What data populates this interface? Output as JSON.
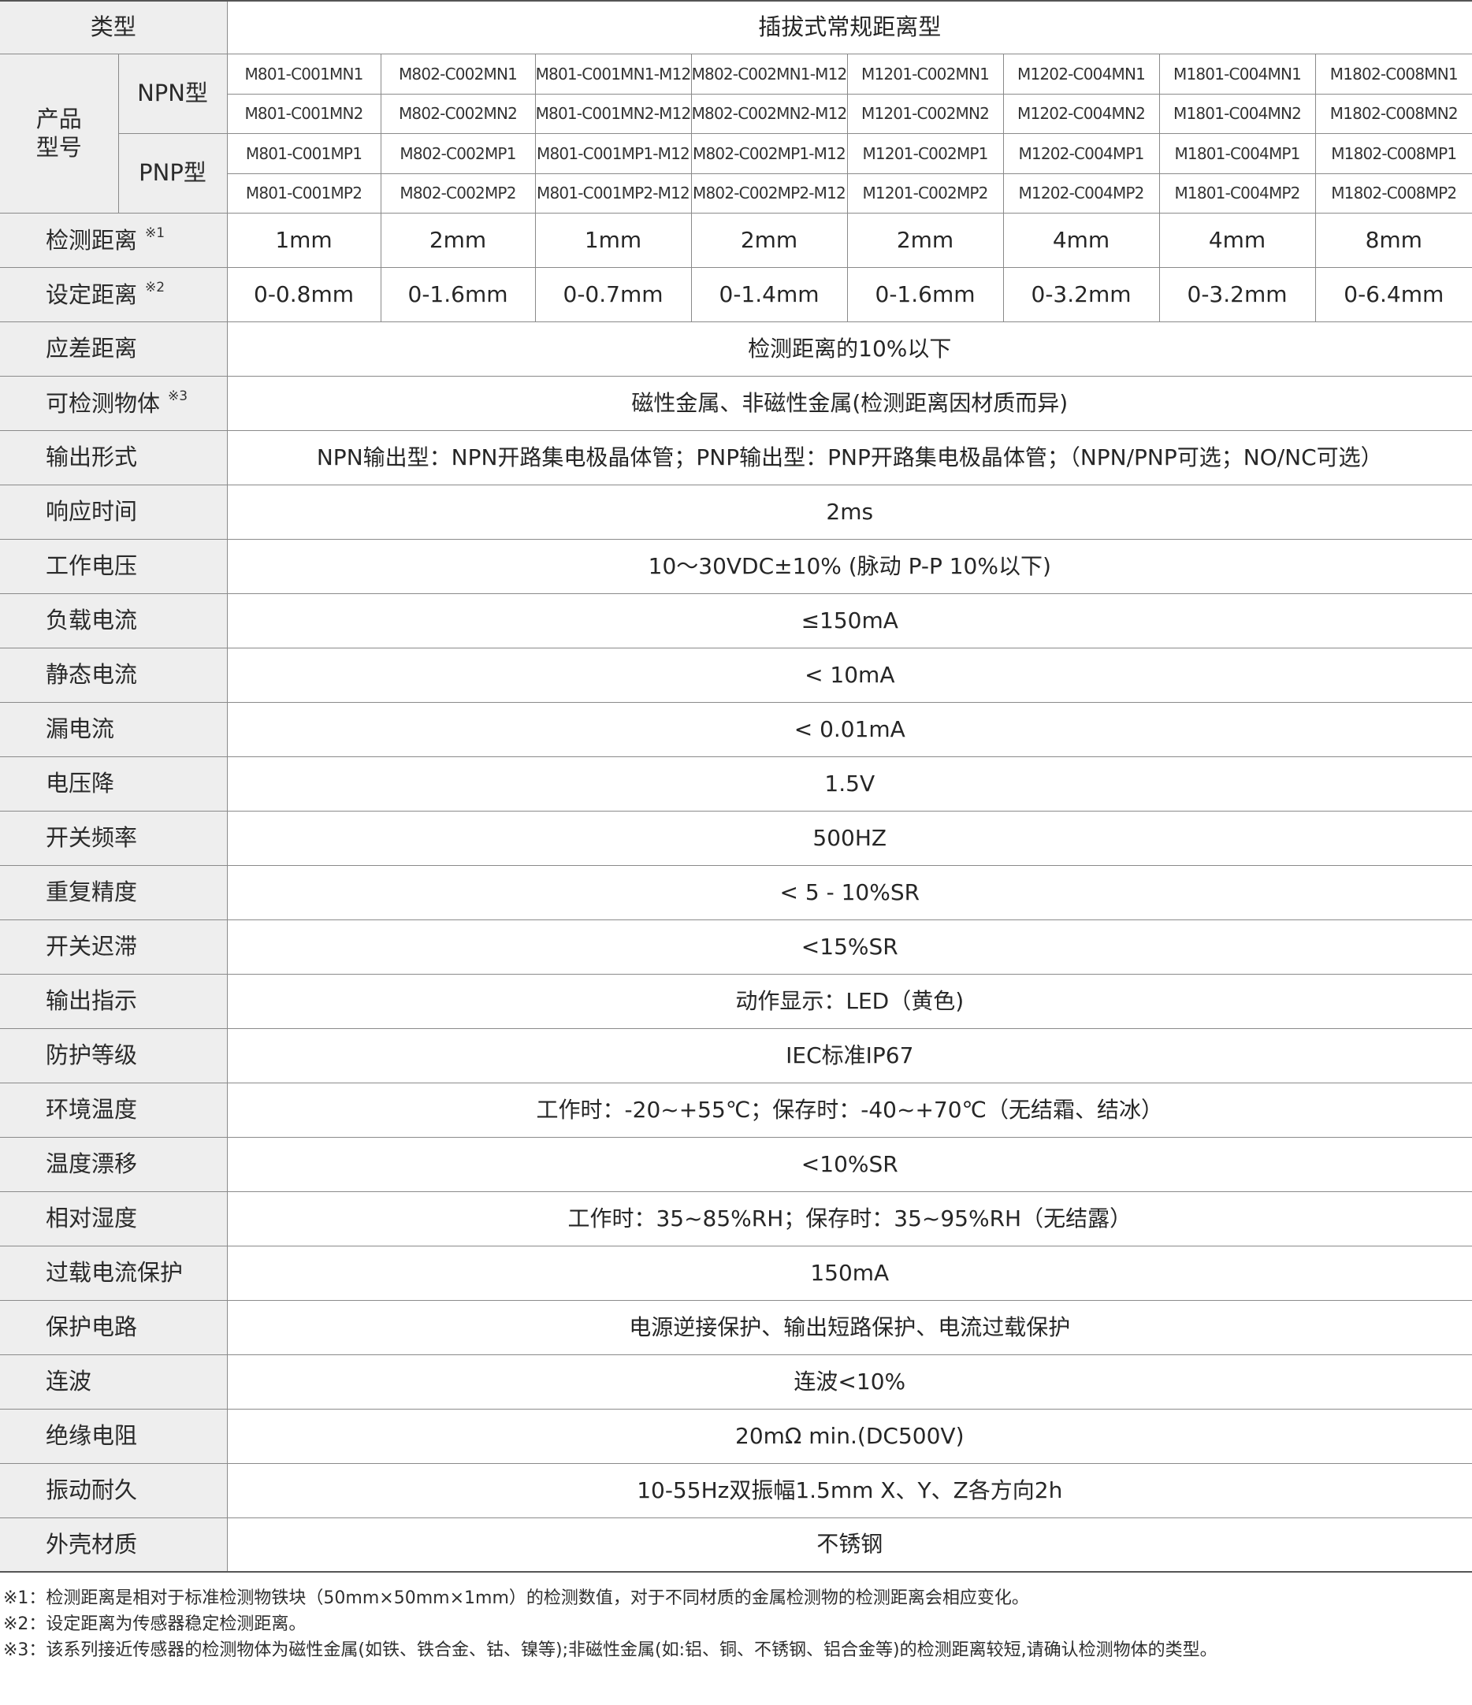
{
  "table": {
    "type_label": "类型",
    "type_value": "插拔式常规距离型",
    "model_label": "产品型号",
    "npn_label": "NPN型",
    "pnp_label": "PNP型",
    "npn_rows": [
      [
        "M801-C001MN1",
        "M802-C002MN1",
        "M801-C001MN1-M12",
        "M802-C002MN1-M12",
        "M1201-C002MN1",
        "M1202-C004MN1",
        "M1801-C004MN1",
        "M1802-C008MN1"
      ],
      [
        "M801-C001MN2",
        "M802-C002MN2",
        "M801-C001MN2-M12",
        "M802-C002MN2-M12",
        "M1201-C002MN2",
        "M1202-C004MN2",
        "M1801-C004MN2",
        "M1802-C008MN2"
      ]
    ],
    "pnp_rows": [
      [
        "M801-C001MP1",
        "M802-C002MP1",
        "M801-C001MP1-M12",
        "M802-C002MP1-M12",
        "M1201-C002MP1",
        "M1202-C004MP1",
        "M1801-C004MP1",
        "M1802-C008MP1"
      ],
      [
        "M801-C001MP2",
        "M802-C002MP2",
        "M801-C001MP2-M12",
        "M802-C002MP2-M12",
        "M1201-C002MP2",
        "M1202-C004MP2",
        "M1801-C004MP2",
        "M1802-C008MP2"
      ]
    ],
    "detect_distance": {
      "label": "检测距离",
      "note": "※1",
      "values": [
        "1mm",
        "2mm",
        "1mm",
        "2mm",
        "2mm",
        "4mm",
        "4mm",
        "8mm"
      ]
    },
    "set_distance": {
      "label": "设定距离",
      "note": "※2",
      "values": [
        "0-0.8mm",
        "0-1.6mm",
        "0-0.7mm",
        "0-1.4mm",
        "0-1.6mm",
        "0-3.2mm",
        "0-3.2mm",
        "0-6.4mm"
      ]
    },
    "hysteresis_distance": {
      "label": "应差距离",
      "value": "检测距离的10%以下"
    },
    "detectable_object": {
      "label": "可检测物体",
      "note": "※3",
      "value": "磁性金属、非磁性金属(检测距离因材质而异)"
    },
    "spec_rows": [
      {
        "label": "输出形式",
        "value": "NPN输出型：NPN开路集电极晶体管；PNP输出型：PNP开路集电极晶体管；（NPN/PNP可选；NO/NC可选）"
      },
      {
        "label": "响应时间",
        "value": "2ms"
      },
      {
        "label": "工作电压",
        "value": "10～30VDC±10% (脉动 P-P 10%以下)"
      },
      {
        "label": "负载电流",
        "value": "≤150mA"
      },
      {
        "label": "静态电流",
        "value": "< 10mA"
      },
      {
        "label": "漏电流",
        "value": "< 0.01mA"
      },
      {
        "label": "电压降",
        "value": "1.5V"
      },
      {
        "label": "开关频率",
        "value": "500HZ"
      },
      {
        "label": "重复精度",
        "value": "< 5 - 10%SR"
      },
      {
        "label": "开关迟滞",
        "value": "<15%SR"
      },
      {
        "label": "输出指示",
        "value": "动作显示：LED（黄色)"
      },
      {
        "label": "防护等级",
        "value": "IEC标准IP67"
      },
      {
        "label": "环境温度",
        "value": "工作时：-20~+55℃；保存时：-40~+70℃（无结霜、结冰）"
      },
      {
        "label": "温度漂移",
        "value": "<10%SR"
      },
      {
        "label": "相对湿度",
        "value": "工作时：35~85%RH；保存时：35~95%RH（无结露）"
      },
      {
        "label": "过载电流保护",
        "value": "150mA"
      },
      {
        "label": "保护电路",
        "value": "电源逆接保护、输出短路保护、电流过载保护"
      },
      {
        "label": "连波",
        "value": "连波<10%"
      },
      {
        "label": "绝缘电阻",
        "value": "20mΩ min.(DC500V)"
      },
      {
        "label": "振动耐久",
        "value": "10-55Hz双振幅1.5mm X、Y、Z各方向2h"
      },
      {
        "label": "外壳材质",
        "value": "不锈钢"
      }
    ]
  },
  "footnotes": [
    "※1：检测距离是相对于标准检测物铁块（50mm×50mm×1mm）的检测数值，对于不同材质的金属检测物的检测距离会相应变化。",
    "※2：设定距离为传感器稳定检测距离。",
    "※3：该系列接近传感器的检测物体为磁性金属(如铁、铁合金、钴、镍等);非磁性金属(如:铝、铜、不锈钢、铝合金等)的检测距离较短,请确认检测物体的类型。"
  ]
}
